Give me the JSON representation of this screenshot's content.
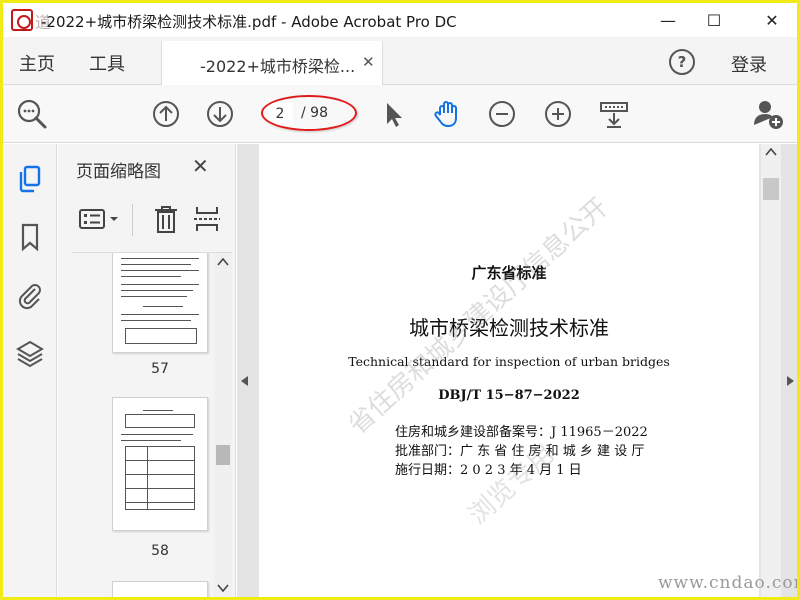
{
  "window": {
    "title": "-2022+城市桥梁检测技术标准.pdf - Adobe Acrobat Pro DC",
    "watermark_logo_text": "道",
    "controls": {
      "minimize": "—",
      "maximize": "☐",
      "close": "✕"
    }
  },
  "menubar": {
    "home_label": "主页",
    "tools_label": "工具",
    "doc_tab_label": "-2022+城市桥梁检...",
    "doc_tab_close": "✕",
    "help_label": "?",
    "login_label": "登录"
  },
  "toolbar": {
    "current_page": "2",
    "total_pages": "/ 98",
    "icons": [
      "search-icon",
      "arrow-up-icon",
      "arrow-down-icon",
      "select-pointer-icon",
      "hand-tool-icon",
      "zoom-out-icon",
      "zoom-in-icon",
      "display-options-icon",
      "share-user-icon"
    ]
  },
  "rail": {
    "icons": [
      "page-thumbnails-icon",
      "bookmark-icon",
      "attachment-icon",
      "layers-icon"
    ]
  },
  "panel": {
    "title": "页面缩略图",
    "close_label": "✕",
    "thumbnails": [
      {
        "page": "57"
      },
      {
        "page": "58"
      }
    ]
  },
  "document": {
    "province_standard": "广东省标准",
    "title_cn": "城市桥梁检测技术标准",
    "title_en": "Technical standard for inspection of urban bridges",
    "code": "DBJ/T 15−87−2022",
    "record_no": "住房和城乡建设部备案号：J 11965－2022",
    "approval_dept": "批准部门：广 东 省 住 房 和 城 乡 建 设 厅",
    "effective_date": "施行日期：2 0 2 3 年 4 月 1 日",
    "watermark_lines": [
      "省住房和城乡建设厅信息公开",
      "浏览专用"
    ]
  },
  "site_watermark": "www.cndao.com",
  "colors": {
    "accent_blue": "#1473e6",
    "highlight_red": "#e01b1b",
    "frame_yellow": "#f2ea14"
  }
}
